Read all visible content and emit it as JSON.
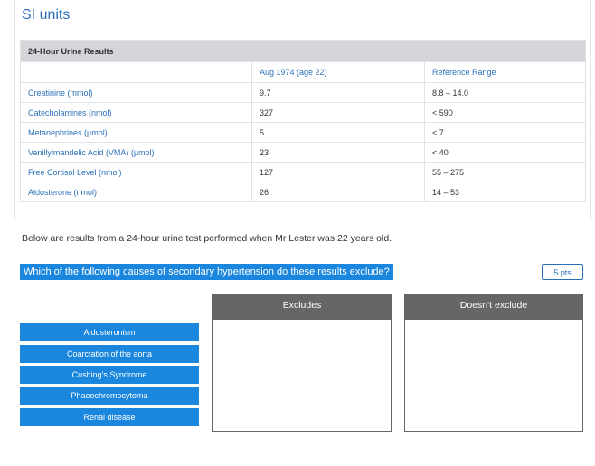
{
  "title": "SI units",
  "table": {
    "caption": "24-Hour Urine Results",
    "headers": [
      "",
      "Aug 1974 (age 22)",
      "Reference Range"
    ],
    "rows": [
      {
        "name": "Creatinine (mmol)",
        "value": "9.7",
        "range": "8.8 – 14.0"
      },
      {
        "name": "Catecholamines (nmol)",
        "value": "327",
        "range": "< 590"
      },
      {
        "name": "Metanephrines (µmol)",
        "value": "5",
        "range": "< 7"
      },
      {
        "name": "Vanillylmandelic Acid (VMA) (µmol)",
        "value": "23",
        "range": "< 40"
      },
      {
        "name": "Free Cortisol Level (nmol)",
        "value": "127",
        "range": "55 – 275"
      },
      {
        "name": "Aldosterone (nmol)",
        "value": "26",
        "range": "14 – 53"
      }
    ]
  },
  "intro": "Below are results from a 24-hour urine test performed when Mr Lester was 22 years old.",
  "question": "Which of the following causes of secondary hypertension do these results exclude?",
  "points": "5 pts",
  "options": [
    "Aldosteronism",
    "Coarctation of the aorta",
    "Cushing's Syndrome",
    "Phaeochromocytoma",
    "Renal disease"
  ],
  "targets": [
    "Excludes",
    "Doesn't exclude"
  ]
}
